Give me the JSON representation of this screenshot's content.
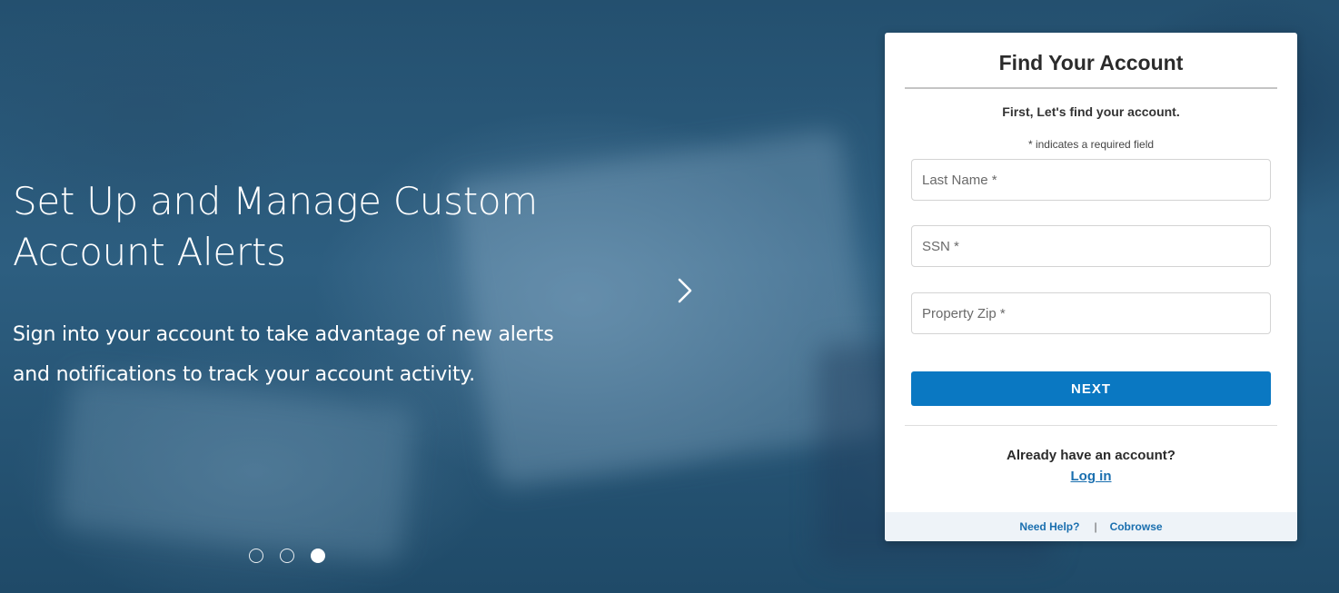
{
  "hero": {
    "title": "Set Up and Manage Custom Account Alerts",
    "subtitle": "Sign into your account to take advantage of new alerts and notifications to track your account activity.",
    "next_icon": "chevron-right-icon",
    "dots": {
      "count": 3,
      "active_index": 2
    }
  },
  "card": {
    "title": "Find Your Account",
    "intro": "First, Let's find your account.",
    "required_note": "* indicates a required field",
    "fields": {
      "last_name_placeholder": "Last Name *",
      "ssn_placeholder": "SSN *",
      "zip_placeholder": "Property Zip *"
    },
    "next_label": "NEXT",
    "already_text": "Already have an account?",
    "login_label": "Log in",
    "footer": {
      "help_label": "Need Help?",
      "separator": "|",
      "cobrowse_label": "Cobrowse"
    }
  },
  "colors": {
    "primary_button": "#0a78c2",
    "link": "#1a6faf",
    "hero_background": "#2d5e80"
  }
}
